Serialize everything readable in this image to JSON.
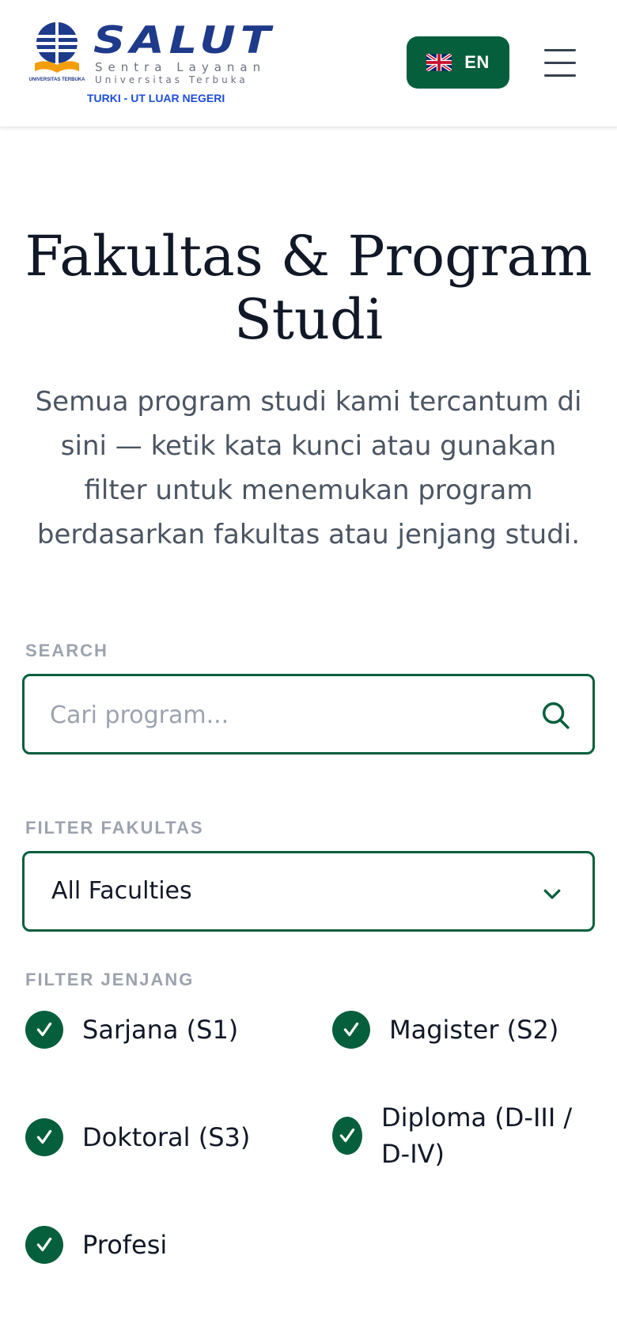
{
  "header": {
    "logo": {
      "wordmark": "SALUT",
      "tagline_line1": "Sentra Layanan",
      "tagline_line2": "Universitas Terbuka",
      "emblem_caption": "UNIVERSITAS TERBUKA",
      "subtitle": "TURKI - UT LUAR NEGERI"
    },
    "language_button": {
      "label": "EN",
      "icon": "uk-flag-icon"
    },
    "menu_icon": "hamburger-menu-icon"
  },
  "hero": {
    "title": "Fakultas & Program Studi",
    "description": "Semua program studi kami tercantum di sini — ketik kata kunci atau gunakan filter untuk menemukan program berdasarkan fakultas atau jenjang studi."
  },
  "search": {
    "label": "SEARCH",
    "placeholder": "Cari program...",
    "value": "",
    "icon": "search-icon"
  },
  "faculty_filter": {
    "label": "FILTER FAKULTAS",
    "selected": "All Faculties",
    "icon": "chevron-down-icon"
  },
  "level_filter": {
    "label": "FILTER JENJANG",
    "options": [
      {
        "label": "Sarjana (S1)",
        "checked": true
      },
      {
        "label": "Magister (S2)",
        "checked": true
      },
      {
        "label": "Doktoral (S3)",
        "checked": true
      },
      {
        "label": "Diploma (D-III / D-IV)",
        "checked": true
      },
      {
        "label": "Profesi",
        "checked": true
      }
    ]
  },
  "colors": {
    "primary_green": "#065f3c",
    "brand_navy": "#1e3a8a",
    "text_dark": "#111827",
    "text_muted": "#4b5563",
    "label_gray": "#9ca3af"
  }
}
